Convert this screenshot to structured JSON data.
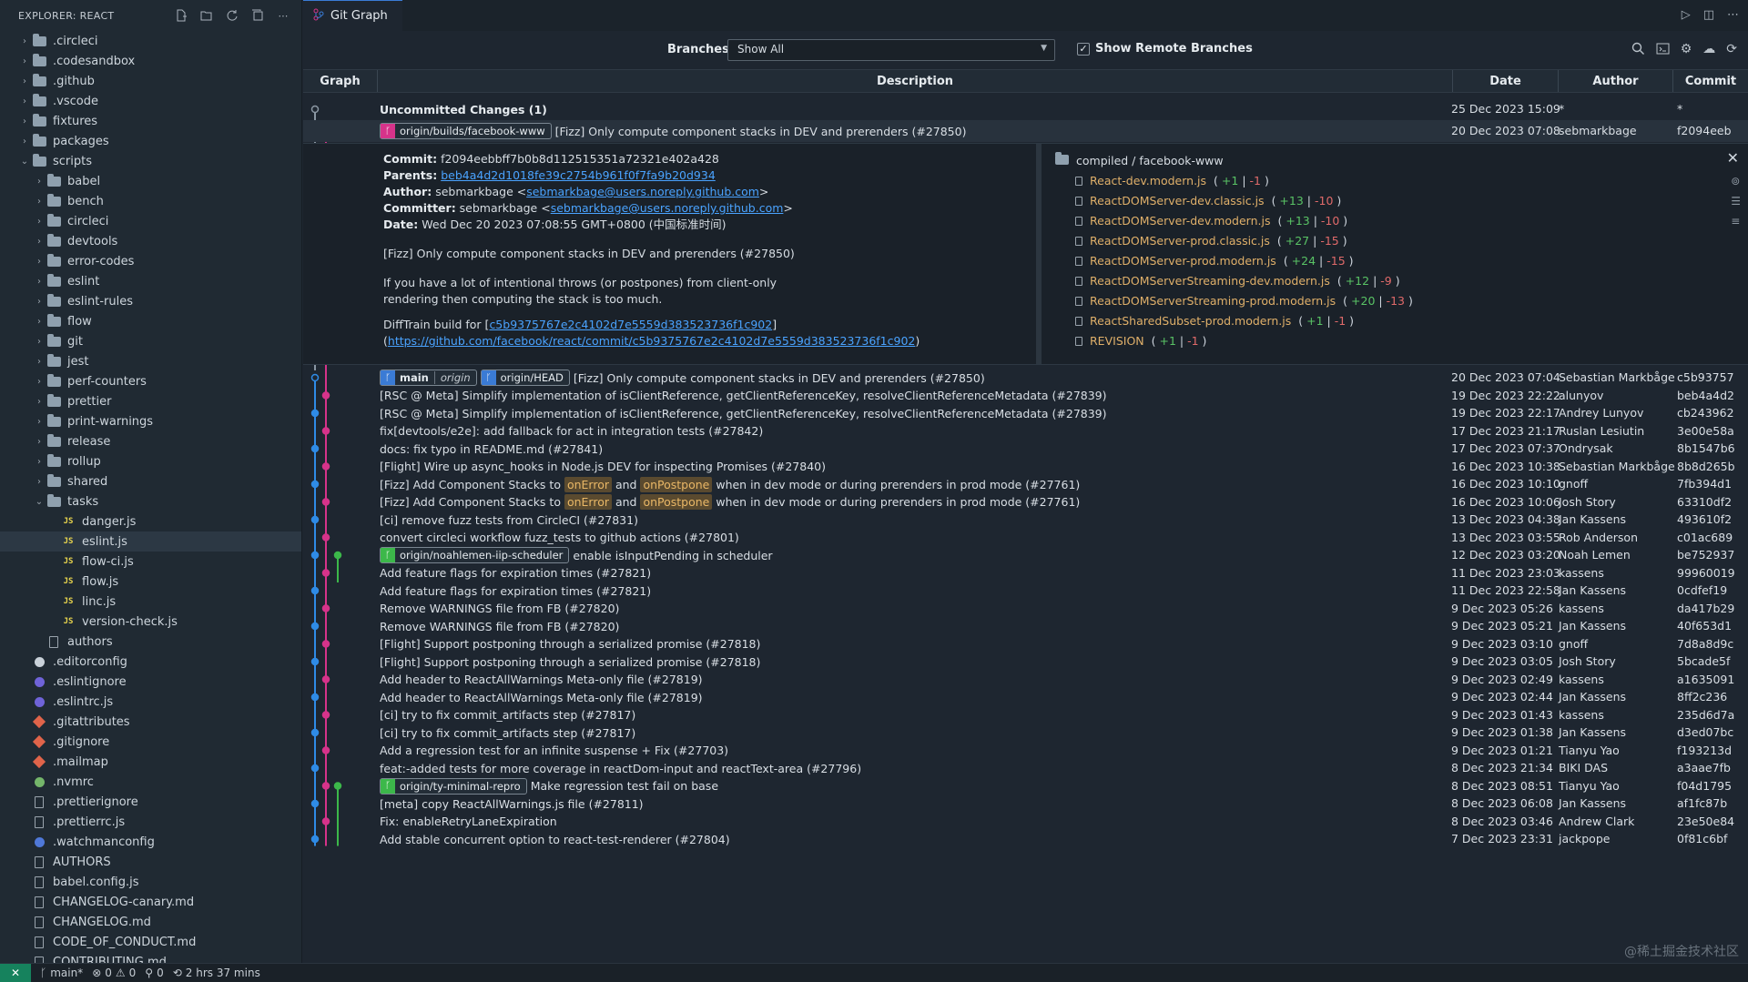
{
  "sidebar": {
    "title": "EXPLORER: REACT",
    "items": [
      {
        "label": ".circleci",
        "type": "folder",
        "depth": 0,
        "state": "closed"
      },
      {
        "label": ".codesandbox",
        "type": "folder",
        "depth": 0,
        "state": "closed"
      },
      {
        "label": ".github",
        "type": "folder",
        "depth": 0,
        "state": "closed"
      },
      {
        "label": ".vscode",
        "type": "folder",
        "depth": 0,
        "state": "closed"
      },
      {
        "label": "fixtures",
        "type": "folder",
        "depth": 0,
        "state": "closed"
      },
      {
        "label": "packages",
        "type": "folder",
        "depth": 0,
        "state": "closed"
      },
      {
        "label": "scripts",
        "type": "folder",
        "depth": 0,
        "state": "open"
      },
      {
        "label": "babel",
        "type": "folder",
        "depth": 1,
        "state": "closed"
      },
      {
        "label": "bench",
        "type": "folder",
        "depth": 1,
        "state": "closed"
      },
      {
        "label": "circleci",
        "type": "folder",
        "depth": 1,
        "state": "closed"
      },
      {
        "label": "devtools",
        "type": "folder",
        "depth": 1,
        "state": "closed"
      },
      {
        "label": "error-codes",
        "type": "folder",
        "depth": 1,
        "state": "closed"
      },
      {
        "label": "eslint",
        "type": "folder",
        "depth": 1,
        "state": "closed"
      },
      {
        "label": "eslint-rules",
        "type": "folder",
        "depth": 1,
        "state": "closed"
      },
      {
        "label": "flow",
        "type": "folder",
        "depth": 1,
        "state": "closed"
      },
      {
        "label": "git",
        "type": "folder",
        "depth": 1,
        "state": "closed"
      },
      {
        "label": "jest",
        "type": "folder",
        "depth": 1,
        "state": "closed"
      },
      {
        "label": "perf-counters",
        "type": "folder",
        "depth": 1,
        "state": "closed"
      },
      {
        "label": "prettier",
        "type": "folder",
        "depth": 1,
        "state": "closed"
      },
      {
        "label": "print-warnings",
        "type": "folder",
        "depth": 1,
        "state": "closed"
      },
      {
        "label": "release",
        "type": "folder",
        "depth": 1,
        "state": "closed"
      },
      {
        "label": "rollup",
        "type": "folder",
        "depth": 1,
        "state": "closed"
      },
      {
        "label": "shared",
        "type": "folder",
        "depth": 1,
        "state": "closed"
      },
      {
        "label": "tasks",
        "type": "folder",
        "depth": 1,
        "state": "open"
      },
      {
        "label": "danger.js",
        "type": "js",
        "depth": 2
      },
      {
        "label": "eslint.js",
        "type": "js",
        "depth": 2,
        "selected": true
      },
      {
        "label": "flow-ci.js",
        "type": "js",
        "depth": 2
      },
      {
        "label": "flow.js",
        "type": "js",
        "depth": 2
      },
      {
        "label": "linc.js",
        "type": "js",
        "depth": 2
      },
      {
        "label": "version-check.js",
        "type": "js",
        "depth": 2
      },
      {
        "label": "authors",
        "type": "file",
        "depth": 1
      },
      {
        "label": ".editorconfig",
        "type": "dot",
        "depth": 0,
        "color": "#c9d1d9"
      },
      {
        "label": ".eslintignore",
        "type": "dot",
        "depth": 0,
        "color": "#6f63d8"
      },
      {
        "label": ".eslintrc.js",
        "type": "dot",
        "depth": 0,
        "color": "#6f63d8"
      },
      {
        "label": ".gitattributes",
        "type": "git",
        "depth": 0
      },
      {
        "label": ".gitignore",
        "type": "git",
        "depth": 0
      },
      {
        "label": ".mailmap",
        "type": "git",
        "depth": 0
      },
      {
        "label": ".nvmrc",
        "type": "dot",
        "depth": 0,
        "color": "#74b56a"
      },
      {
        "label": ".prettierignore",
        "type": "file",
        "depth": 0
      },
      {
        "label": ".prettierrc.js",
        "type": "file",
        "depth": 0
      },
      {
        "label": ".watchmanconfig",
        "type": "dot",
        "depth": 0,
        "color": "#4f78d8"
      },
      {
        "label": "AUTHORS",
        "type": "file",
        "depth": 0
      },
      {
        "label": "babel.config.js",
        "type": "file",
        "depth": 0
      },
      {
        "label": "CHANGELOG-canary.md",
        "type": "file",
        "depth": 0
      },
      {
        "label": "CHANGELOG.md",
        "type": "file",
        "depth": 0
      },
      {
        "label": "CODE_OF_CONDUCT.md",
        "type": "file",
        "depth": 0
      },
      {
        "label": "CONTRIBUTING.md",
        "type": "file",
        "depth": 0
      }
    ]
  },
  "tab": {
    "label": "Git Graph"
  },
  "controls": {
    "branches_label": "Branches:",
    "branches_value": "Show All",
    "show_remote_label": "Show Remote Branches",
    "show_remote_checked": "✓"
  },
  "table_head": {
    "graph": "Graph",
    "description": "Description",
    "date": "Date",
    "author": "Author",
    "commit": "Commit"
  },
  "uncommitted": {
    "desc": "Uncommitted Changes (1)",
    "date": "25 Dec 2023 15:09",
    "author": "*",
    "commit": "*"
  },
  "selected_commit": {
    "ref": "origin/builds/facebook-www",
    "desc": "[Fizz] Only compute component stacks in DEV and prerenders (#27850)",
    "date": "20 Dec 2023 07:08",
    "author": "sebmarkbage",
    "commit": "f2094eeb"
  },
  "details": {
    "commit_label": "Commit:",
    "commit_value": "f2094eebbff7b0b8d112515351a72321e402a428",
    "parents_label": "Parents:",
    "parents_value": "beb4a4d2d1018fe39c2754b961f0f7fa9b20d934",
    "author_label": "Author:",
    "author_name": "sebmarkbage <",
    "author_email": "sebmarkbage@users.noreply.github.com",
    "author_close": ">",
    "committer_label": "Committer:",
    "committer_name": "sebmarkbage <",
    "committer_email": "sebmarkbage@users.noreply.github.com",
    "committer_close": ">",
    "date_label": "Date:",
    "date_value": "Wed Dec 20 2023 07:08:55 GMT+0800 (中国标准时间)",
    "message_title": "[Fizz] Only compute component stacks in DEV and prerenders (#27850)",
    "message_body_1": "If you have a lot of intentional throws (or postpones) from client-only",
    "message_body_2": "rendering then computing the stack is too much.",
    "difftrain_prefix": "DiffTrain build for [",
    "difftrain_hash": "c5b9375767e2c4102d7e5559d383523736f1c902",
    "difftrain_suffix": "]",
    "difftrain_link_open": "(",
    "difftrain_link": "https://github.com/facebook/react/commit/c5b9375767e2c4102d7e5559d383523736f1c902",
    "difftrain_link_close": ")",
    "dir": "compiled / facebook-www",
    "files": [
      {
        "name": "React-dev.modern.js",
        "add": "+1",
        "del": "-1"
      },
      {
        "name": "ReactDOMServer-dev.classic.js",
        "add": "+13",
        "del": "-10"
      },
      {
        "name": "ReactDOMServer-dev.modern.js",
        "add": "+13",
        "del": "-10"
      },
      {
        "name": "ReactDOMServer-prod.classic.js",
        "add": "+27",
        "del": "-15"
      },
      {
        "name": "ReactDOMServer-prod.modern.js",
        "add": "+24",
        "del": "-15"
      },
      {
        "name": "ReactDOMServerStreaming-dev.modern.js",
        "add": "+12",
        "del": "-9"
      },
      {
        "name": "ReactDOMServerStreaming-prod.modern.js",
        "add": "+20",
        "del": "-13"
      },
      {
        "name": "ReactSharedSubset-prod.modern.js",
        "add": "+1",
        "del": "-1"
      },
      {
        "name": "REVISION",
        "add": "+1",
        "del": "-1"
      }
    ]
  },
  "commits": [
    {
      "refs": [
        {
          "name": "main",
          "sub": "origin",
          "color": "#3a7bd5"
        },
        {
          "name": "origin/HEAD",
          "color": "#3a7bd5"
        }
      ],
      "desc": "[Fizz] Only compute component stacks in DEV and prerenders (#27850)",
      "date": "20 Dec 2023 07:04",
      "author": "Sebastian Markbåge",
      "commit": "c5b93757"
    },
    {
      "desc": "[RSC @ Meta] Simplify implementation of isClientReference, getClientReferenceKey, resolveClientReferenceMetadata (#27839)",
      "date": "19 Dec 2023 22:22",
      "author": "alunyov",
      "commit": "beb4a4d2"
    },
    {
      "desc": "[RSC @ Meta] Simplify implementation of isClientReference, getClientReferenceKey, resolveClientReferenceMetadata (#27839)",
      "date": "19 Dec 2023 22:17",
      "author": "Andrey Lunyov",
      "commit": "cb243962"
    },
    {
      "desc": "fix[devtools/e2e]: add fallback for act in integration tests (#27842)",
      "date": "17 Dec 2023 21:17",
      "author": "Ruslan Lesiutin",
      "commit": "3e00e58a"
    },
    {
      "desc": "docs: fix typo in README.md (#27841)",
      "date": "17 Dec 2023 07:37",
      "author": "Ondrysak",
      "commit": "8b1547b6"
    },
    {
      "desc": "[Flight] Wire up async_hooks in Node.js DEV for inspecting Promises (#27840)",
      "date": "16 Dec 2023 10:38",
      "author": "Sebastian Markbåge",
      "commit": "8b8d265b"
    },
    {
      "desc_parts": [
        "[Fizz] Add Component Stacks to ",
        "onError",
        " and ",
        "onPostpone",
        " when in dev mode or during prerenders in prod mode (#27761)"
      ],
      "date": "16 Dec 2023 10:10",
      "author": "gnoff",
      "commit": "7fb394d1"
    },
    {
      "desc_parts": [
        "[Fizz] Add Component Stacks to ",
        "onError",
        " and ",
        "onPostpone",
        " when in dev mode or during prerenders in prod mode (#27761)"
      ],
      "date": "16 Dec 2023 10:06",
      "author": "Josh Story",
      "commit": "63310df2"
    },
    {
      "desc": "[ci] remove fuzz tests from CircleCI (#27831)",
      "date": "13 Dec 2023 04:38",
      "author": "Jan Kassens",
      "commit": "493610f2"
    },
    {
      "desc": "convert circleci workflow fuzz_tests to github actions (#27801)",
      "date": "13 Dec 2023 03:55",
      "author": "Rob Anderson",
      "commit": "c01ac689"
    },
    {
      "refs": [
        {
          "name": "origin/noahlemen-iip-scheduler",
          "color": "#3cb84a"
        }
      ],
      "desc": "enable isInputPending in scheduler",
      "date": "12 Dec 2023 03:20",
      "author": "Noah Lemen",
      "commit": "be752937"
    },
    {
      "desc": "Add feature flags for expiration times (#27821)",
      "date": "11 Dec 2023 23:03",
      "author": "kassens",
      "commit": "99960019"
    },
    {
      "desc": "Add feature flags for expiration times (#27821)",
      "date": "11 Dec 2023 22:58",
      "author": "Jan Kassens",
      "commit": "0cdfef19"
    },
    {
      "desc": "Remove WARNINGS file from FB (#27820)",
      "date": "9 Dec 2023 05:26",
      "author": "kassens",
      "commit": "da417b29"
    },
    {
      "desc": "Remove WARNINGS file from FB (#27820)",
      "date": "9 Dec 2023 05:21",
      "author": "Jan Kassens",
      "commit": "40f653d1"
    },
    {
      "desc": "[Flight] Support postponing through a serialized promise (#27818)",
      "date": "9 Dec 2023 03:10",
      "author": "gnoff",
      "commit": "7d8a8d9c"
    },
    {
      "desc": "[Flight] Support postponing through a serialized promise (#27818)",
      "date": "9 Dec 2023 03:05",
      "author": "Josh Story",
      "commit": "5bcade5f"
    },
    {
      "desc": "Add header to ReactAllWarnings Meta-only file (#27819)",
      "date": "9 Dec 2023 02:49",
      "author": "kassens",
      "commit": "a1635091"
    },
    {
      "desc": "Add header to ReactAllWarnings Meta-only file (#27819)",
      "date": "9 Dec 2023 02:44",
      "author": "Jan Kassens",
      "commit": "8ff2c236"
    },
    {
      "desc": "[ci] try to fix commit_artifacts step (#27817)",
      "date": "9 Dec 2023 01:43",
      "author": "kassens",
      "commit": "235d6d7a"
    },
    {
      "desc": "[ci] try to fix commit_artifacts step (#27817)",
      "date": "9 Dec 2023 01:38",
      "author": "Jan Kassens",
      "commit": "d3ed07bc"
    },
    {
      "desc": "Add a regression test for an infinite suspense + Fix (#27703)",
      "date": "9 Dec 2023 01:21",
      "author": "Tianyu Yao",
      "commit": "f193213d"
    },
    {
      "desc": "feat:-added tests for more coverage in reactDom-input and reactText-area (#27796)",
      "date": "8 Dec 2023 21:34",
      "author": "BIKI DAS",
      "commit": "a3aae7fb"
    },
    {
      "refs": [
        {
          "name": "origin/ty-minimal-repro",
          "color": "#3cb84a"
        }
      ],
      "desc": "Make regression test fail on base",
      "date": "8 Dec 2023 08:51",
      "author": "Tianyu Yao",
      "commit": "f04d1795"
    },
    {
      "desc": "[meta] copy ReactAllWarnings.js file (#27811)",
      "date": "8 Dec 2023 06:08",
      "author": "Jan Kassens",
      "commit": "af1fc87b"
    },
    {
      "desc": "Fix: enableRetryLaneExpiration",
      "date": "8 Dec 2023 03:46",
      "author": "Andrew Clark",
      "commit": "23e50e84"
    },
    {
      "desc": "Add stable concurrent option to react-test-renderer (#27804)",
      "date": "7 Dec 2023 23:31",
      "author": "jackpope",
      "commit": "0f81c6bf"
    }
  ],
  "statusbar": {
    "branch": "main*",
    "errors": "0",
    "warnings": "0",
    "ports": "0",
    "time": "2 hrs 37 mins"
  },
  "watermark": "@稀土掘金技术社区",
  "colors": {
    "accent": "#3a7bd5",
    "magenta": "#d6338a",
    "green": "#3cb84a",
    "blue_graph": "#2f8be6"
  }
}
